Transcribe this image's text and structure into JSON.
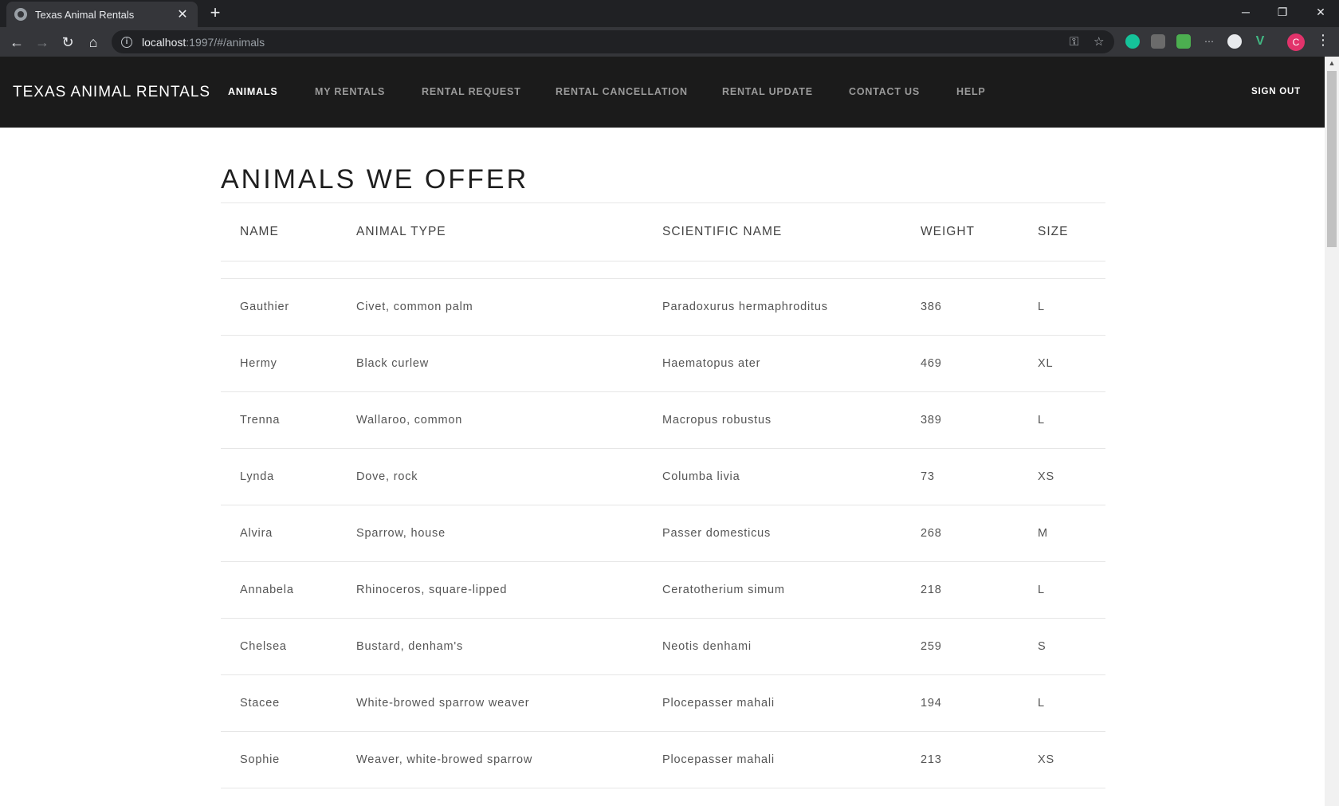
{
  "browser": {
    "tab_title": "Texas Animal Rentals",
    "url_host": "localhost",
    "url_path": ":1997/#/animals",
    "profile_initial": "C"
  },
  "app": {
    "brand": "TEXAS ANIMAL RENTALS",
    "nav": [
      "ANIMALS",
      "MY RENTALS",
      "RENTAL REQUEST",
      "RENTAL CANCELLATION",
      "RENTAL UPDATE",
      "CONTACT US",
      "HELP"
    ],
    "active_nav": "ANIMALS",
    "sign_out": "SIGN OUT"
  },
  "page": {
    "title": "ANIMALS WE OFFER",
    "columns": [
      "NAME",
      "ANIMAL TYPE",
      "SCIENTIFIC NAME",
      "WEIGHT",
      "SIZE"
    ],
    "rows": [
      [
        "Gauthier",
        "Civet, common palm",
        "Paradoxurus hermaphroditus",
        "386",
        "L"
      ],
      [
        "Hermy",
        "Black curlew",
        "Haematopus ater",
        "469",
        "XL"
      ],
      [
        "Trenna",
        "Wallaroo, common",
        "Macropus robustus",
        "389",
        "L"
      ],
      [
        "Lynda",
        "Dove, rock",
        "Columba livia",
        "73",
        "XS"
      ],
      [
        "Alvira",
        "Sparrow, house",
        "Passer domesticus",
        "268",
        "M"
      ],
      [
        "Annabela",
        "Rhinoceros, square-lipped",
        "Ceratotherium simum",
        "218",
        "L"
      ],
      [
        "Chelsea",
        "Bustard, denham's",
        "Neotis denhami",
        "259",
        "S"
      ],
      [
        "Stacee",
        "White-browed sparrow weaver",
        "Plocepasser mahali",
        "194",
        "L"
      ],
      [
        "Sophie",
        "Weaver, white-browed sparrow",
        "Plocepasser mahali",
        "213",
        "XS"
      ]
    ]
  }
}
